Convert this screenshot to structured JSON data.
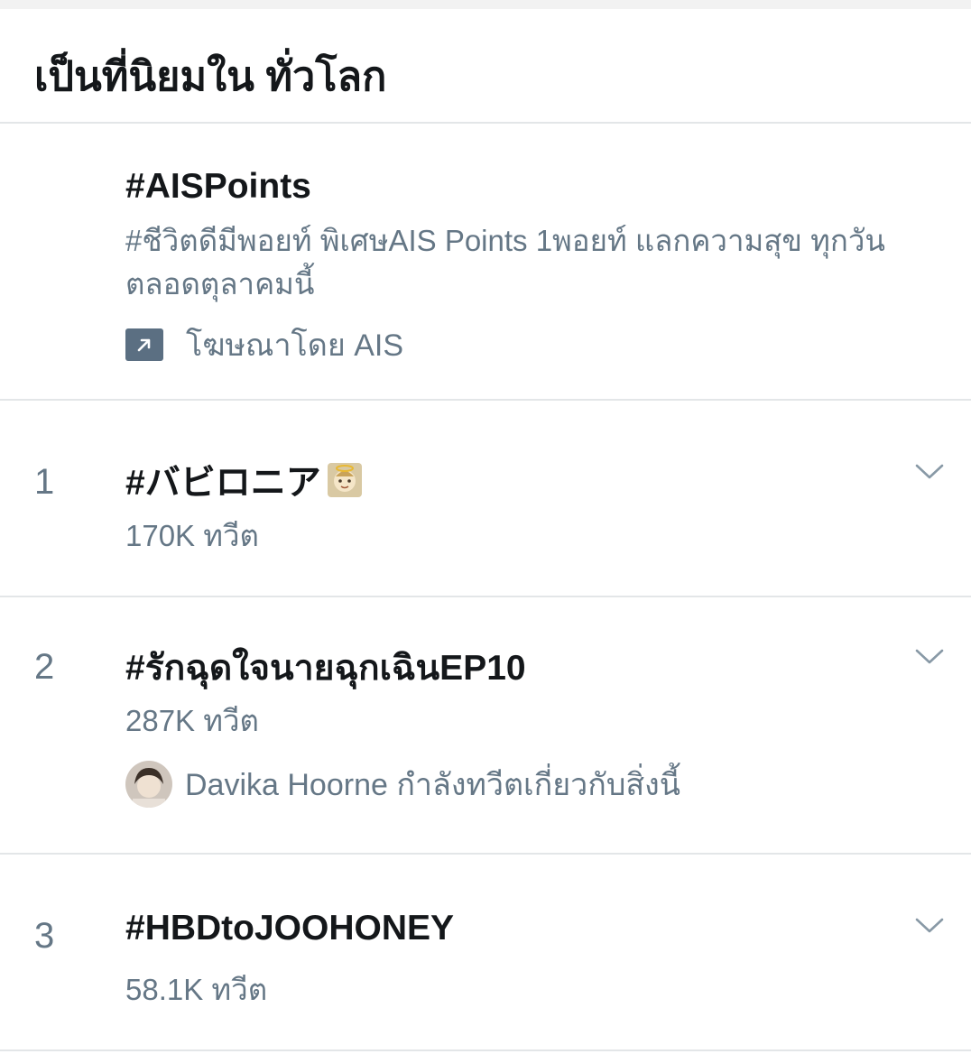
{
  "header": {
    "title": "เป็นที่นิยมใน ทั่วโลก"
  },
  "promoted": {
    "name": "#AISPoints",
    "description": "#ชีวิตดีมีพอยท์ พิเศษAIS Points 1พอยท์ แลกความสุข ทุกวันตลอดตุลาคมนี้",
    "promoted_label": "โฆษณาโดย AIS"
  },
  "trends": [
    {
      "rank": "1",
      "name": "#バビロニア",
      "count": "170K ทวีต",
      "icon": "angel-emoji"
    },
    {
      "rank": "2",
      "name": "#รักฉุดใจนายฉุกเฉินEP10",
      "count": "287K ทวีต",
      "context": {
        "user": "Davika Hoorne",
        "text": "Davika Hoorne กำลังทวีตเกี่ยวกับสิ่งนี้"
      }
    },
    {
      "rank": "3",
      "name": "#HBDtoJOOHONEY",
      "count": "58.1K ทวีต"
    }
  ],
  "icons": {
    "chevron": "chevron-down-icon",
    "promoted": "promoted-arrow-icon"
  },
  "colors": {
    "primary_text": "#14171a",
    "secondary_text": "#657786",
    "divider": "#e3e6e8",
    "promo_icon_bg": "#5b6f82"
  }
}
